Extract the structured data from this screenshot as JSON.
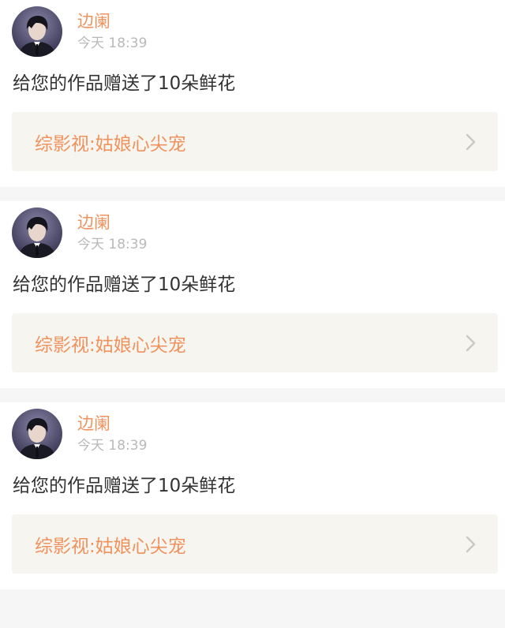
{
  "notifications": [
    {
      "username": "边阑",
      "time": "今天 18:39",
      "message": "给您的作品赠送了10朵鲜花",
      "work_title": "综影视:姑娘心尖宠",
      "avatar_icon": "user-avatar-icon",
      "chevron_icon": "chevron-right-icon"
    },
    {
      "username": "边阑",
      "time": "今天 18:39",
      "message": "给您的作品赠送了10朵鲜花",
      "work_title": "综影视:姑娘心尖宠",
      "avatar_icon": "user-avatar-icon",
      "chevron_icon": "chevron-right-icon"
    },
    {
      "username": "边阑",
      "time": "今天 18:39",
      "message": "给您的作品赠送了10朵鲜花",
      "work_title": "综影视:姑娘心尖宠",
      "avatar_icon": "user-avatar-icon",
      "chevron_icon": "chevron-right-icon"
    }
  ],
  "colors": {
    "accent": "#f0925e",
    "time": "#b9b9b9",
    "text": "#333333",
    "link_bg": "#f6f5f0",
    "page_bg": "#f6f6f6"
  }
}
